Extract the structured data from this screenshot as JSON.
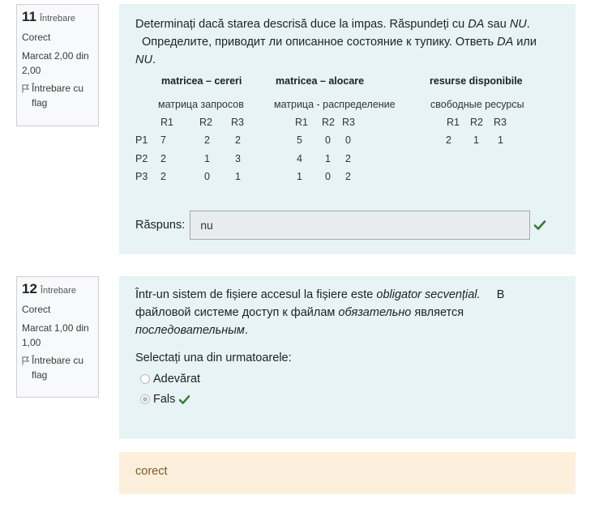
{
  "q11": {
    "number": "11",
    "word": "Întrebare",
    "status": "Corect",
    "mark_line1": "Marcat 2,00 din",
    "mark_line2": "2,00",
    "flag_line1": "Întrebare cu",
    "flag_line2": "flag",
    "text_ro_pre": "Determinați dacă starea descrisă duce la impas. Răspundeți cu ",
    "text_ro_da": "DA",
    "text_ro_mid": " sau ",
    "text_ro_nu": "NU",
    "text_ro_end": ".",
    "text_ru_pre": "Определите, приводит ли описанное состояние к тупику. Ответь ",
    "text_ru_da": "DA",
    "text_ru_mid": " или",
    "text_ru_nu": "NU",
    "text_ru_end": ".",
    "table": {
      "h_req": "matricea – cereri",
      "h_alloc": "matricea – alocare",
      "h_avail": "resurse disponibile",
      "s_req": "матрица запросов",
      "s_alloc": "матрица - распределение",
      "s_avail": "свободные ресурсы",
      "cols": [
        "R1",
        "R2",
        "R3"
      ],
      "procs": [
        "P1",
        "P2",
        "P3"
      ],
      "req": [
        [
          "7",
          "2",
          "2"
        ],
        [
          "2",
          "1",
          "3"
        ],
        [
          "2",
          "0",
          "1"
        ]
      ],
      "alloc": [
        [
          "5",
          "0",
          "0"
        ],
        [
          "4",
          "1",
          "2"
        ],
        [
          "1",
          "0",
          "2"
        ]
      ],
      "avail": [
        "2",
        "1",
        "1"
      ]
    },
    "answer_label": "Răspuns:",
    "answer_value": "nu"
  },
  "q12": {
    "number": "12",
    "word": "Întrebare",
    "status": "Corect",
    "mark_line1": "Marcat 1,00 din",
    "mark_line2": "1,00",
    "flag_line1": "Întrebare cu",
    "flag_line2": "flag",
    "text_ro_pre": "Într-un sistem de fișiere accesul la fișiere este ",
    "text_ro_em": "obligator secvențial.",
    "text_ro_post": "     В",
    "text_ru_pre": "файловой системе доступ к файлам ",
    "text_ru_em1": "обязательно",
    "text_ru_post": " является",
    "text_ru_em2": "последовательным",
    "text_ru_end": ".",
    "prompt": "Selectați una din urmatoarele:",
    "options": [
      "Adevărat",
      "Fals"
    ],
    "selected": 1
  },
  "feedback": "corect",
  "colors": {
    "correct": "#357a32",
    "content_bg": "#e7f3f5",
    "feedback_bg": "#fcefdc"
  }
}
